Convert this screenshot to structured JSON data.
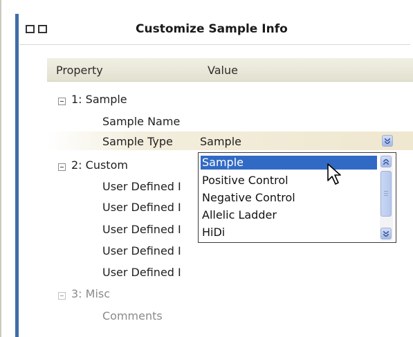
{
  "window": {
    "title": "Customize Sample Info"
  },
  "grid": {
    "headers": {
      "property": "Property",
      "value": "Value"
    },
    "groups": [
      {
        "label": "1: Sample",
        "rows": [
          {
            "property": "Sample Name",
            "value": ""
          },
          {
            "property": "Sample Type",
            "value": "Sample"
          }
        ]
      },
      {
        "label": "2: Custom",
        "rows": [
          {
            "property": "User Defined I"
          },
          {
            "property": "User Defined I"
          },
          {
            "property": "User Defined I"
          },
          {
            "property": "User Defined I"
          },
          {
            "property": "User Defined I"
          }
        ]
      },
      {
        "label": "3: Misc",
        "rows": [
          {
            "property": "Comments"
          }
        ]
      }
    ]
  },
  "dropdown": {
    "selected": "Sample",
    "options": [
      "Sample",
      "Positive Control",
      "Negative Control",
      "Allelic Ladder",
      "HiDi"
    ]
  },
  "icons": {
    "expander": "collapse-minus-icon",
    "dropdown": "chevron-down-icon",
    "scroll_up": "chevron-up-icon",
    "scroll_down": "chevron-down-icon",
    "cursor": "mouse-pointer-icon"
  },
  "colors": {
    "selection": "#316ac5",
    "accent_bar": "#3e6fa8",
    "header_bg": "#e8e6d6"
  }
}
